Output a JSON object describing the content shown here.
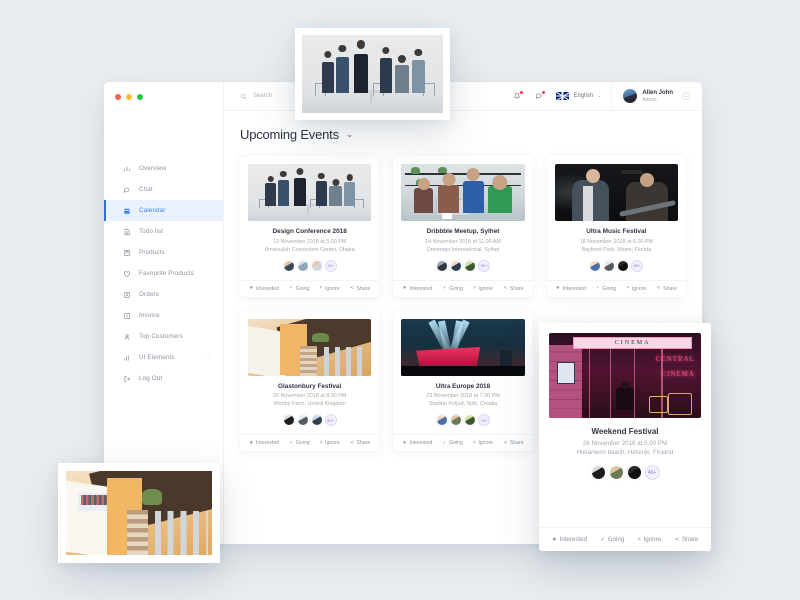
{
  "window": {
    "traffic_lights": [
      "close",
      "minimize",
      "maximize"
    ]
  },
  "search": {
    "placeholder": "Search",
    "icon": "search-icon"
  },
  "header": {
    "notification_icon": "bell-icon",
    "message_icon": "chat-bubble-icon",
    "flag_icon": "uk-flag-icon",
    "language": "English",
    "language_caret": "⌄",
    "user_name": "Allen John",
    "user_role": "Admin",
    "user_caret": "⌄"
  },
  "sidebar": {
    "items": [
      {
        "label": "Overview",
        "icon": "bar-chart-icon",
        "active": false
      },
      {
        "label": "Chat",
        "icon": "chat-icon",
        "active": false
      },
      {
        "label": "Calendar",
        "icon": "calendar-icon",
        "active": true
      },
      {
        "label": "Todo list",
        "icon": "checklist-icon",
        "active": false
      },
      {
        "label": "Products",
        "icon": "box-icon",
        "active": false
      },
      {
        "label": "Favourite Products",
        "icon": "heart-icon",
        "active": false
      },
      {
        "label": "Orders",
        "icon": "clipboard-icon",
        "active": false
      },
      {
        "label": "Invoice",
        "icon": "invoice-icon",
        "active": false
      },
      {
        "label": "Top Customers",
        "icon": "user-icon",
        "active": false
      },
      {
        "label": "UI Elements",
        "icon": "stats-icon",
        "active": false,
        "chevron": "›"
      }
    ],
    "logout": {
      "label": "Log Out",
      "icon": "logout-icon"
    }
  },
  "page": {
    "title": "Upcoming Events",
    "title_caret": "⌄"
  },
  "actions": {
    "interested": {
      "label": "Interested",
      "icon": "star-icon",
      "glyph": "★"
    },
    "going": {
      "label": "Going",
      "icon": "check-icon",
      "glyph": "✓"
    },
    "ignore": {
      "label": "Ignore",
      "icon": "close-icon",
      "glyph": "×"
    },
    "share": {
      "label": "Share",
      "icon": "share-icon",
      "glyph": "≺"
    }
  },
  "events": [
    {
      "title": "Design Conference 2018",
      "date": "13 November 2018 at 5.00 PM",
      "location": "Amanullah Convection Center, Dhaka",
      "attendees_more": "15+",
      "photo": "conference-photo"
    },
    {
      "title": "Dribbble Meetup, Sylhet",
      "date": "14 November 2018 at 11.00 AM",
      "location": "Omnnego International, Sylhet",
      "attendees_more": "90+",
      "photo": "meetup-photo"
    },
    {
      "title": "Ultra Music Festival",
      "date": "18 November 2018 at 8.00 PM",
      "location": "Bayfront Park, Miami, Florida",
      "attendees_more": "85+",
      "photo": "music-festival-photo"
    },
    {
      "title": "Glastonbury Festival",
      "date": "20 November 2018 at 8.00 PM",
      "location": "Worthy Farm, United Kingdom",
      "attendees_more": "80+",
      "photo": "glastonbury-photo"
    },
    {
      "title": "Ultra Europe 2018",
      "date": "23 November 2018 at 7.00 PM",
      "location": "Stadion Poljud, Split, Croatia",
      "attendees_more": "78+",
      "photo": "ultra-europe-photo"
    }
  ],
  "featured_event": {
    "title": "Weekend Festival",
    "date": "26 November 2018 at 5.00 PM",
    "location": "Hietaniemi beach, Helsinki, Finland",
    "attendees_more": "46+",
    "photo": "cinema-photo"
  },
  "floating_photos": [
    {
      "name": "conference-photo-overlay"
    },
    {
      "name": "santorini-photo-overlay"
    }
  ],
  "colors": {
    "canvas": "#e9edf0",
    "accent": "#3b82f6",
    "active_bg": "#e9f1fe",
    "badge_red": "#ff3b46",
    "more_badge_text": "#8b7ee8",
    "muted_text": "#a3aab5"
  }
}
